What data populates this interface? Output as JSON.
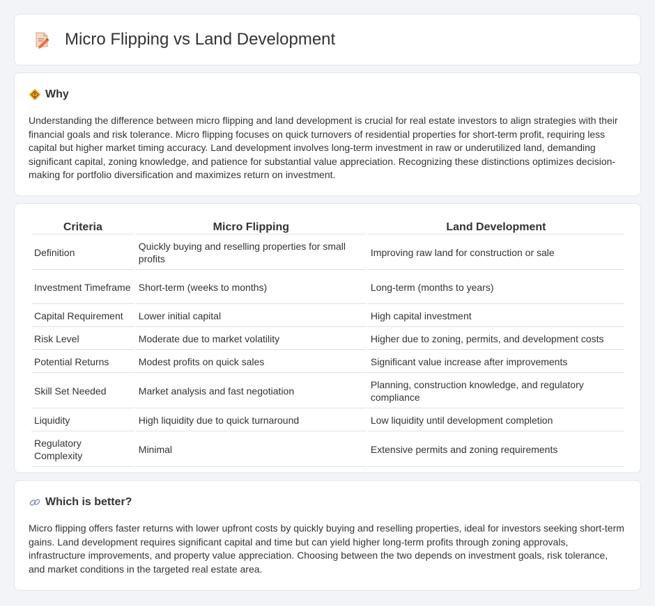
{
  "header": {
    "title": "Micro Flipping vs Land Development",
    "icon": "document-pencil-icon"
  },
  "why": {
    "title": "Why",
    "icon": "diamond-sign-icon",
    "text": "Understanding the difference between micro flipping and land development is crucial for real estate investors to align strategies with their financial goals and risk tolerance. Micro flipping focuses on quick turnovers of residential properties for short-term profit, requiring less capital but higher market timing accuracy. Land development involves long-term investment in raw or underutilized land, demanding significant capital, zoning knowledge, and patience for substantial value appreciation. Recognizing these distinctions optimizes decision-making for portfolio diversification and maximizes return on investment."
  },
  "table": {
    "headers": [
      "Criteria",
      "Micro Flipping",
      "Land Development"
    ],
    "rows": [
      [
        "Definition",
        "Quickly buying and reselling properties for small profits",
        "Improving raw land for construction or sale"
      ],
      [
        "Investment Timeframe",
        "Short-term (weeks to months)",
        "Long-term (months to years)"
      ],
      [
        "Capital Requirement",
        "Lower initial capital",
        "High capital investment"
      ],
      [
        "Risk Level",
        "Moderate due to market volatility",
        "Higher due to zoning, permits, and development costs"
      ],
      [
        "Potential Returns",
        "Modest profits on quick sales",
        "Significant value increase after improvements"
      ],
      [
        "Skill Set Needed",
        "Market analysis and fast negotiation",
        "Planning, construction knowledge, and regulatory compliance"
      ],
      [
        "Liquidity",
        "High liquidity due to quick turnaround",
        "Low liquidity until development completion"
      ],
      [
        "Regulatory Complexity",
        "Minimal",
        "Extensive permits and zoning requirements"
      ]
    ]
  },
  "better": {
    "title": "Which is better?",
    "icon": "link-icon",
    "text": "Micro flipping offers faster returns with lower upfront costs by quickly buying and reselling properties, ideal for investors seeking short-term gains. Land development requires significant capital and time but can yield higher long-term profits through zoning approvals, infrastructure improvements, and property value appreciation. Choosing between the two depends on investment goals, risk tolerance, and market conditions in the targeted real estate area."
  }
}
